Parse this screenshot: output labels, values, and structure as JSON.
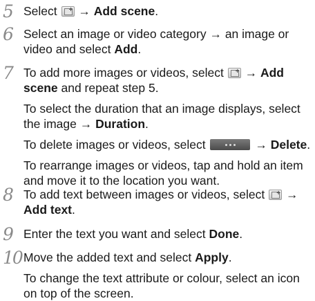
{
  "steps": [
    {
      "number": "5",
      "p1": {
        "t1": "Select ",
        "t2": " → ",
        "b1": "Add scene",
        "t3": "."
      }
    },
    {
      "number": "6",
      "p1": {
        "t1": "Select an image or video category → an image or video and select ",
        "b1": "Add",
        "t2": "."
      }
    },
    {
      "number": "7",
      "p1": {
        "t1": "To add more images or videos, select ",
        "t2": " → ",
        "b1": "Add scene",
        "t3": " and repeat step 5."
      },
      "p2": {
        "t1": "To select the duration that an image displays, select the image → ",
        "b1": "Duration",
        "t2": "."
      },
      "p3": {
        "t1": "To delete images or videos, select ",
        "t2": " → ",
        "b1": "Delete",
        "t3": "."
      },
      "p4": {
        "t1": "To rearrange images or videos, tap and hold an item and move it to the location you want."
      }
    },
    {
      "number": "8",
      "p1": {
        "t1": "To add text between images or videos, select ",
        "t2": " → ",
        "b1": "Add text",
        "t3": "."
      }
    },
    {
      "number": "9",
      "p1": {
        "t1": "Enter the text you want and select ",
        "b1": "Done",
        "t2": "."
      }
    },
    {
      "number": "10",
      "p1": {
        "t1": "Move the added text and select ",
        "b1": "Apply",
        "t2": "."
      },
      "p2": {
        "t1": "To change the text attribute or colour, select an icon on top of the screen."
      }
    }
  ],
  "icons": {
    "add_scene": "add-media-icon",
    "more": "more-options-icon"
  }
}
